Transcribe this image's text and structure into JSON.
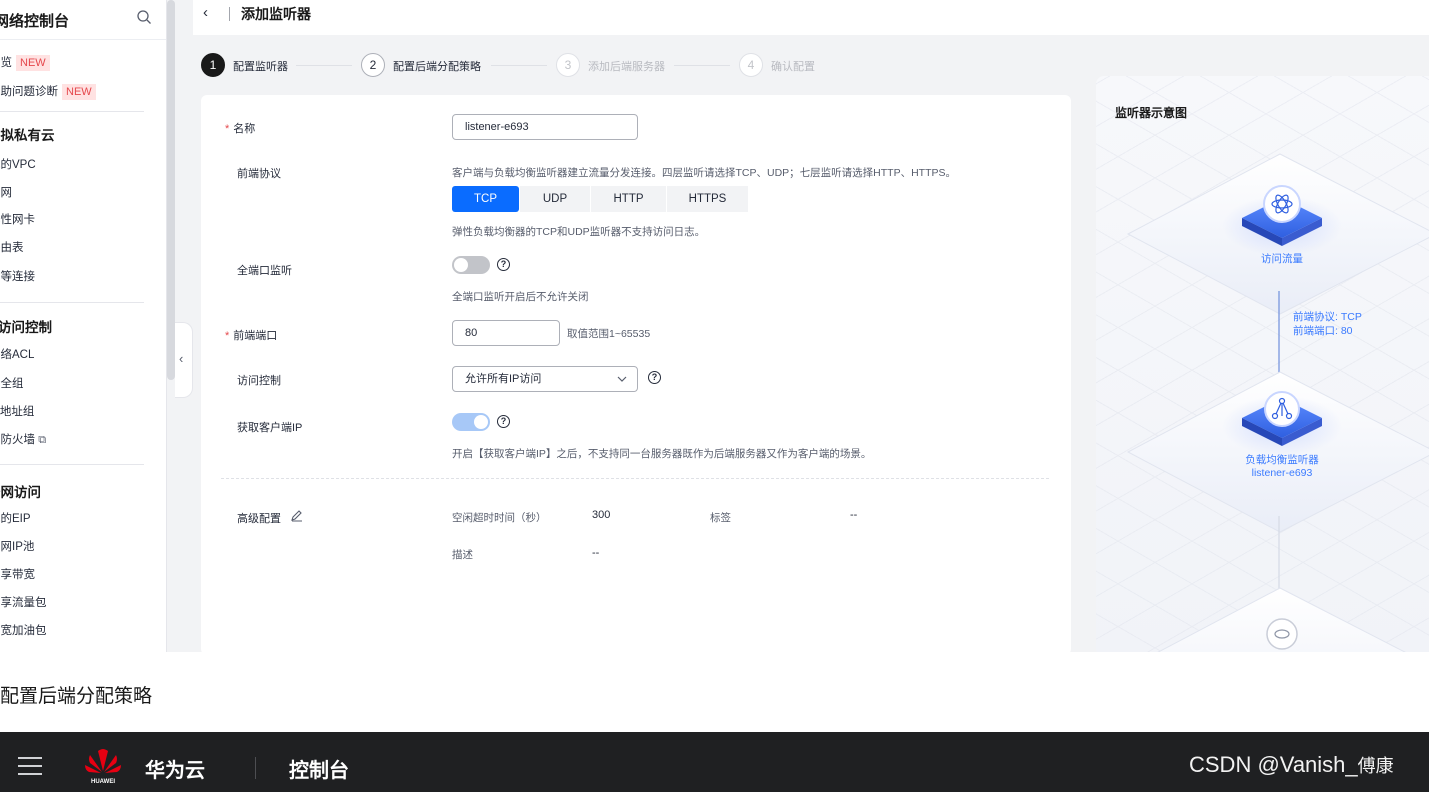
{
  "sidebar": {
    "title": "网络控制台",
    "items_top": [
      {
        "label": "总览",
        "badge": "NEW"
      },
      {
        "label": "辅助问题诊断",
        "badge": "NEW"
      }
    ],
    "group_vpc": "虚拟私有云",
    "vpc_items": [
      "我的VPC",
      "子网",
      "弹性网卡",
      "路由表",
      "对等连接"
    ],
    "group_acl": "访问控制",
    "acl_items": [
      "网络ACL",
      "安全组",
      "IP地址组",
      "云防火墙"
    ],
    "group_public": "公网访问",
    "public_items": [
      "我的EIP",
      "公网IP池",
      "共享带宽",
      "共享流量包",
      "带宽加油包"
    ]
  },
  "header": {
    "back": "‹",
    "title": "添加监听器"
  },
  "steps": [
    {
      "num": "1",
      "label": "配置监听器"
    },
    {
      "num": "2",
      "label": "配置后端分配策略"
    },
    {
      "num": "3",
      "label": "添加后端服务器"
    },
    {
      "num": "4",
      "label": "确认配置"
    }
  ],
  "form": {
    "name_label": "名称",
    "name_value": "listener-e693",
    "protocol_label": "前端协议",
    "protocol_hint": "客户端与负载均衡监听器建立流量分发连接。四层监听请选择TCP、UDP；七层监听请选择HTTP、HTTPS。",
    "protocols": [
      "TCP",
      "UDP",
      "HTTP",
      "HTTPS"
    ],
    "protocol_selected": "TCP",
    "protocol_note": "弹性负载均衡器的TCP和UDP监听器不支持访问日志。",
    "allport_label": "全端口监听",
    "allport_on": false,
    "allport_note": "全端口监听开启后不允许关闭",
    "port_label": "前端端口",
    "port_value": "80",
    "port_range": "取值范围1~65535",
    "acl_label": "访问控制",
    "acl_value": "允许所有IP访问",
    "clientip_label": "获取客户端IP",
    "clientip_on": true,
    "clientip_note": "开启【获取客户端IP】之后，不支持同一台服务器既作为后端服务器又作为客户端的场景。",
    "advanced_label": "高级配置",
    "idle_label": "空闲超时时间（秒）",
    "idle_value": "300",
    "tag_label": "标签",
    "tag_value": "--",
    "desc_label": "描述",
    "desc_value": "--"
  },
  "diagram": {
    "title": "监听器示意图",
    "node1": "访问流量",
    "conn_protocol": "前端协议: TCP",
    "conn_port": "前端端口: 80",
    "node2_line1": "负载均衡监听器",
    "node2_line2": "listener-e693"
  },
  "below": {
    "section_text": "配置后端分配策略",
    "brand_logo_text": "HUAWEI",
    "brand": "华为云",
    "console": "控制台",
    "watermark": "CSDN @Vanish_",
    "watermark_tail": "傅康"
  },
  "colors": {
    "primary": "#0a6cff",
    "required": "#e5484d",
    "accent_link": "#3b7bff"
  }
}
